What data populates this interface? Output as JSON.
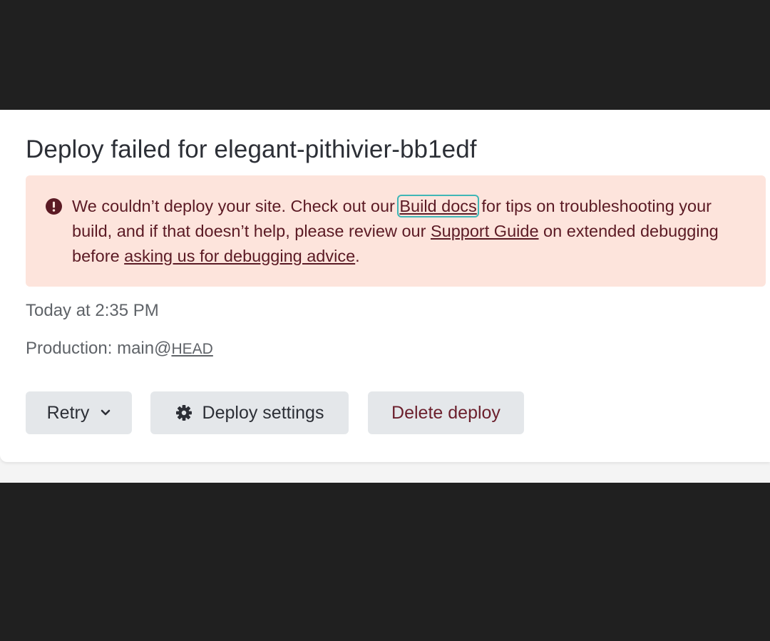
{
  "deploy": {
    "title": "Deploy failed for elegant-pithivier-bb1edf"
  },
  "alert": {
    "text_1": "We couldn’t deploy your site. Check out our ",
    "link_build_docs": "Build docs",
    "text_2": " for tips on troubleshooting your build, and if that doesn’t help, please review our ",
    "link_support_guide": "Support Guide",
    "text_3": " on extended debugging before ",
    "link_debug_advice": "asking us for debugging advice",
    "text_4": ".",
    "icon": "exclamation-circle-icon"
  },
  "meta": {
    "time": "Today at 2:35 PM",
    "branch_prefix": "Production: main@",
    "branch_ref": "HEAD"
  },
  "actions": {
    "retry_label": "Retry",
    "settings_label": "Deploy settings",
    "delete_label": "Delete deploy"
  },
  "colors": {
    "alert_bg": "#fde4dc",
    "alert_text": "#5b1a24",
    "button_bg": "#e4e7ea",
    "focus_ring": "#3fb6b6"
  }
}
